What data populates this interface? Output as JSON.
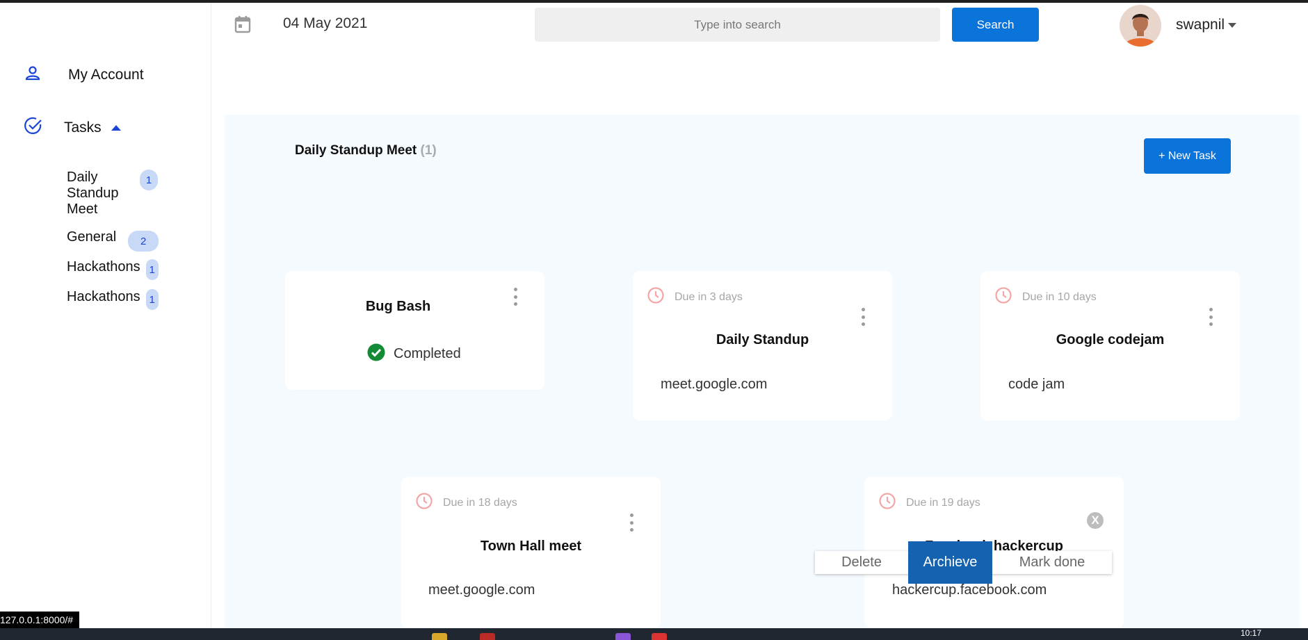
{
  "header": {
    "date": "04 May 2021",
    "search_placeholder": "Type into search",
    "search_button": "Search",
    "username": "swapnil"
  },
  "sidebar": {
    "my_account": "My Account",
    "tasks": "Tasks",
    "subitems": [
      {
        "label": "Daily Standup Meet",
        "count": "1"
      },
      {
        "label": "General",
        "count": "2"
      },
      {
        "label": "Hackathons",
        "count": "1"
      },
      {
        "label": "Hackathons",
        "count": "1"
      }
    ]
  },
  "main": {
    "section_title": "Daily Standup Meet",
    "section_count": "(1)",
    "new_task_button": "+ New Task",
    "cards": [
      {
        "title": "Bug Bash",
        "status": "Completed"
      },
      {
        "due": "Due in 3 days",
        "title": "Daily Standup",
        "link": "meet.google.com"
      },
      {
        "due": "Due in 10 days",
        "title": "Google codejam",
        "link": "code jam"
      },
      {
        "due": "Due in 18 days",
        "title": "Town Hall meet",
        "link": "meet.google.com"
      },
      {
        "due": "Due in 19 days",
        "title": "Facebook hackercup",
        "link": "hackercup.facebook.com"
      }
    ],
    "close_label": "X",
    "actions": {
      "delete": "Delete",
      "archive": "Archieve",
      "mark_done": "Mark done"
    }
  },
  "status_bar": {
    "url": "127.0.0.1:8000/#",
    "time": "10:17"
  },
  "colors": {
    "accent": "#0a74da",
    "clock": "#f4a6a6",
    "completed": "#138a36",
    "badge_bg": "#c8d9f7"
  },
  "icons": [
    "calendar-icon",
    "person-icon",
    "check-circle-icon",
    "clock-icon",
    "more-vertical-icon",
    "checkmark-circle-icon",
    "close-icon",
    "caret-up-icon",
    "caret-down-icon"
  ]
}
